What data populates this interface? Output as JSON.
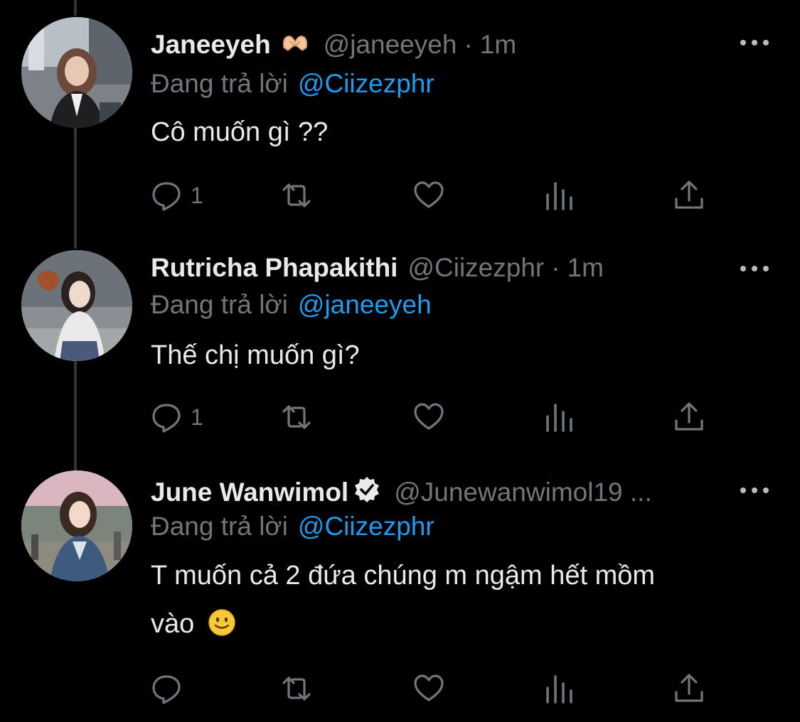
{
  "tweets": [
    {
      "name": "Janeeyeh",
      "name_emoji": "🫶",
      "handle": "@janeeyeh",
      "separator": "·",
      "time": "1m",
      "reply_prefix": "Đang trả lời",
      "reply_to": "@Ciizezphr",
      "text": "Cô muốn gì ??",
      "reply_count": "1",
      "verified": false
    },
    {
      "name": "Rutricha Phapakithi",
      "handle": "@Ciizezphr",
      "separator": "·",
      "time": "1m",
      "reply_prefix": "Đang trả lời",
      "reply_to": "@janeeyeh",
      "text": "Thế chị muốn gì?",
      "reply_count": "1",
      "verified": false
    },
    {
      "name": "June Wanwimol",
      "handle": "@Junewanwimol19 ...",
      "reply_prefix": "Đang trả lời",
      "reply_to": "@Ciizezphr",
      "text_line1": "T muốn cả 2 đứa chúng m ngậm hết mồm",
      "text_line2": "vào",
      "text_emoji": "smiling-face",
      "reply_count": "",
      "verified": true
    }
  ],
  "icons": {
    "reply": "reply-icon",
    "retweet": "retweet-icon",
    "like": "heart-icon",
    "analytics": "analytics-icon",
    "share": "share-icon",
    "more": "more-icon"
  },
  "colors": {
    "background": "#000000",
    "primary_text": "#e7e9ea",
    "secondary_text": "#71767b",
    "link": "#1d9bf0",
    "thread_line": "#333639"
  }
}
